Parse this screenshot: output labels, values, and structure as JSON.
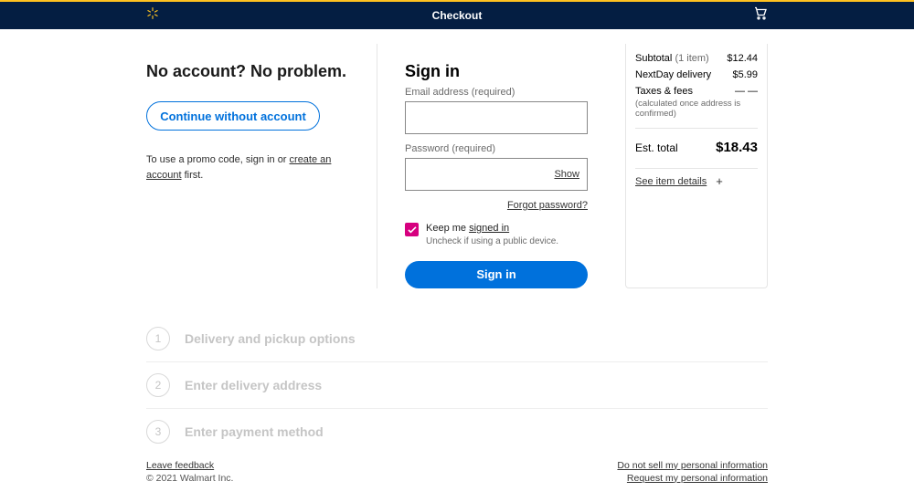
{
  "header": {
    "title": "Checkout"
  },
  "noAccount": {
    "heading": "No account? No problem.",
    "button": "Continue without account",
    "promoPrefix": "To use a promo code, sign in or ",
    "promoLink": "create an account",
    "promoSuffix": " first."
  },
  "signin": {
    "heading": "Sign in",
    "emailLabel": "Email address (required)",
    "passwordLabel": "Password (required)",
    "showLabel": "Show",
    "forgot": "Forgot password?",
    "keepMePrefix": "Keep me ",
    "keepMeLink": "signed in",
    "keepMeSub": "Uncheck if using a public device.",
    "submit": "Sign in"
  },
  "summary": {
    "subtotalLabel": "Subtotal",
    "subtotalCount": "(1 item)",
    "subtotalValue": "$12.44",
    "deliveryLabel": "NextDay delivery",
    "deliveryValue": "$5.99",
    "taxesLabel": "Taxes & fees",
    "taxesValue": "— —",
    "taxesNote": "(calculated once address is confirmed)",
    "estLabel": "Est. total",
    "estValue": "$18.43",
    "detailsLink": "See item details"
  },
  "steps": [
    {
      "num": "1",
      "label": "Delivery and pickup options"
    },
    {
      "num": "2",
      "label": "Enter delivery address"
    },
    {
      "num": "3",
      "label": "Enter payment method"
    }
  ],
  "footer": {
    "feedback": "Leave feedback",
    "copyright": "© 2021 Walmart Inc.",
    "doNotSell": "Do not sell my personal information",
    "request": "Request my personal information"
  }
}
